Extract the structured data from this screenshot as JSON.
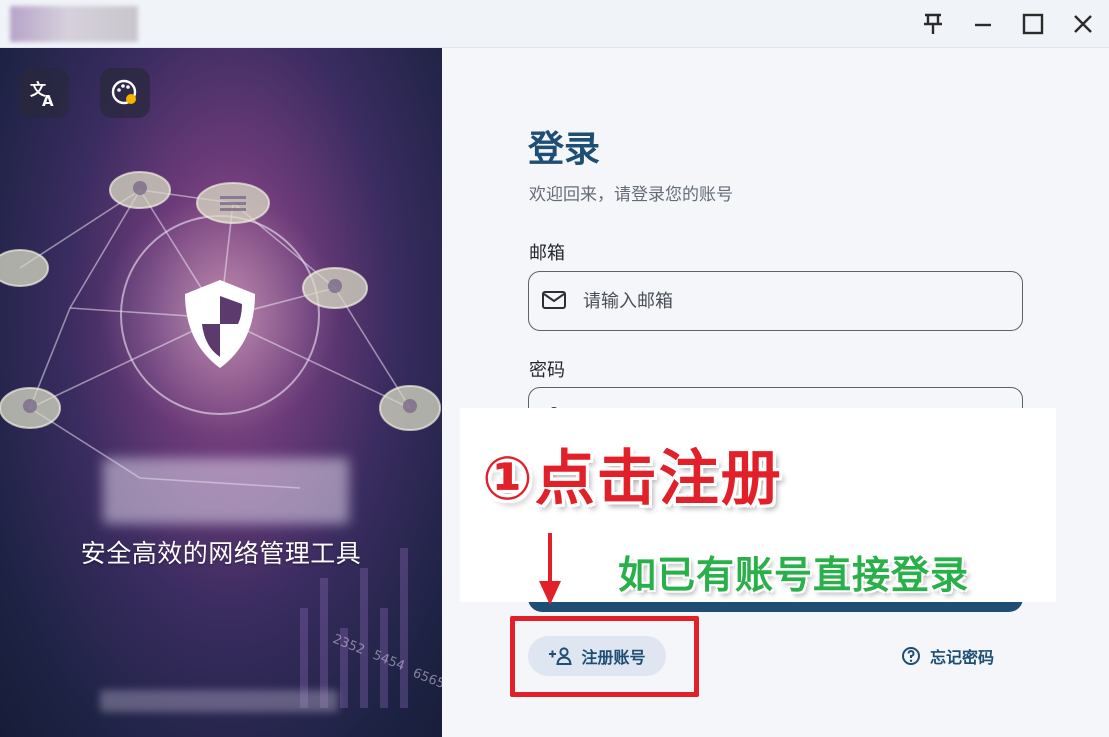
{
  "titlebar": {
    "pin_icon": "pin-icon",
    "minimize_icon": "minimize-icon",
    "maximize_icon": "maximize-icon",
    "close_icon": "close-icon"
  },
  "hero": {
    "translate_icon": "translate-icon",
    "theme_icon": "palette-icon",
    "tagline": "安全高效的网络管理工具",
    "numbers": [
      "2352",
      "5454",
      "6565"
    ]
  },
  "login": {
    "title": "登录",
    "subtitle": "欢迎回来，请登录您的账号",
    "email": {
      "label": "邮箱",
      "placeholder": "请输入邮箱",
      "value": ""
    },
    "password": {
      "label": "密码",
      "placeholder": "",
      "value": ""
    },
    "register_label": "注册账号",
    "forgot_label": "忘记密码"
  },
  "overlay": {
    "step_text": "①点击注册",
    "note_text": "如已有账号直接登录"
  },
  "colors": {
    "primary": "#1f4e74",
    "annotation_red": "#e2202a",
    "annotation_green": "#2ab04a"
  }
}
